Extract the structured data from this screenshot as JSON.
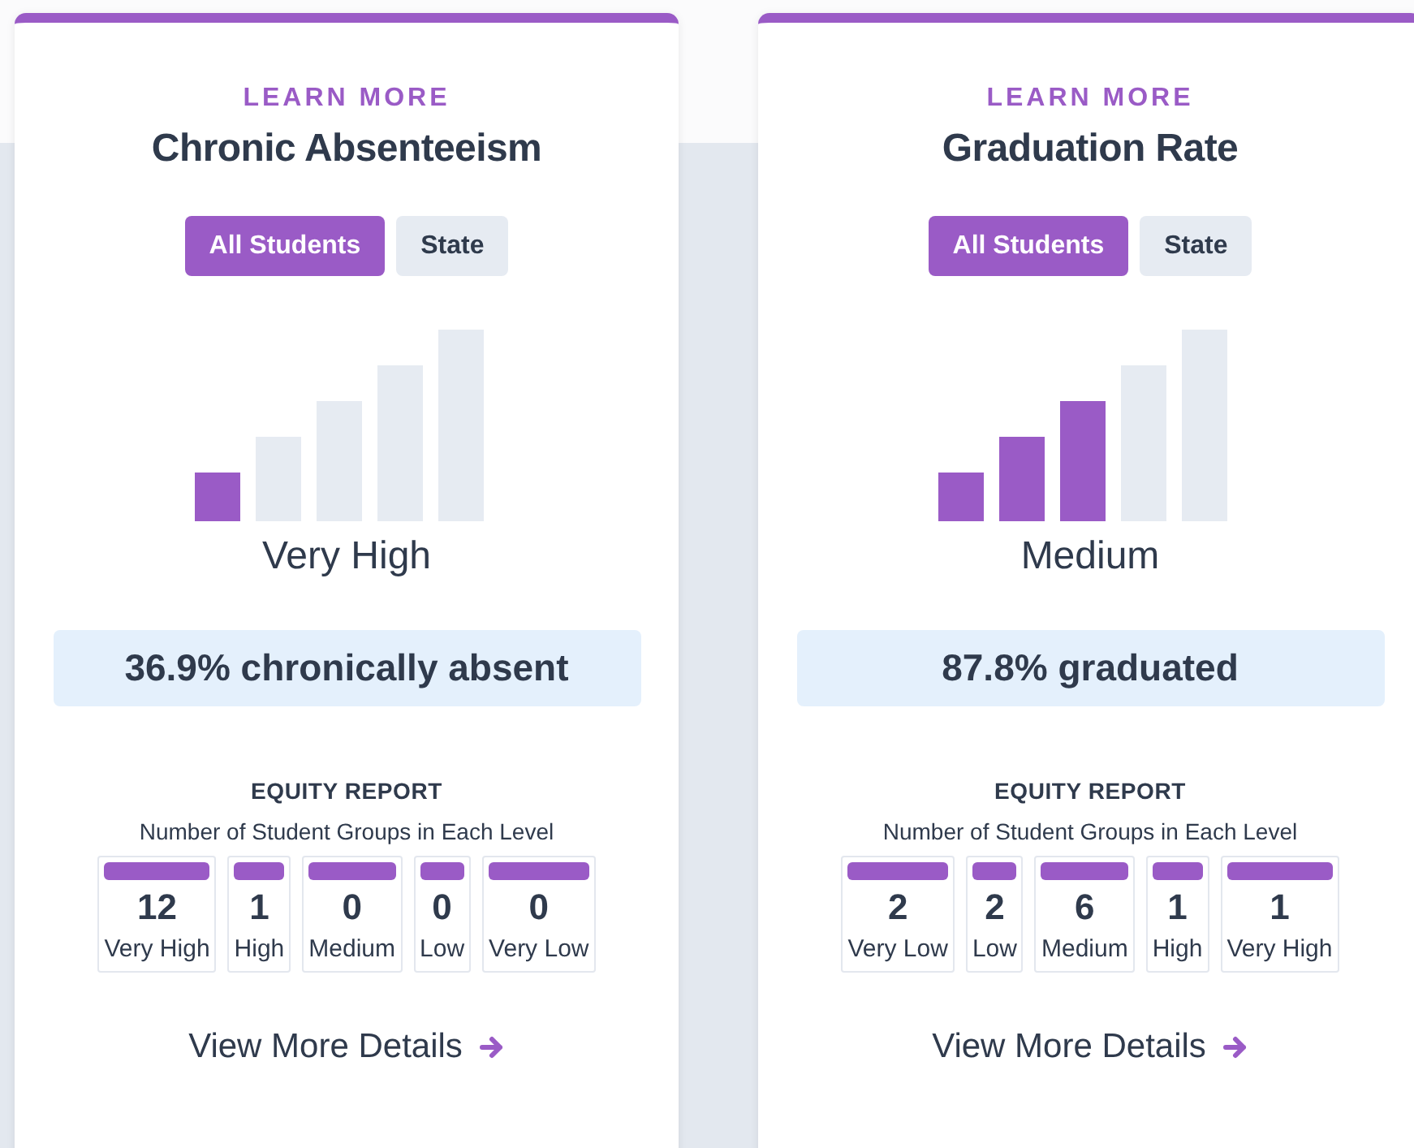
{
  "cards": [
    {
      "link": "LEARN MORE",
      "title": "Chronic Absenteeism",
      "toggles": [
        {
          "label": "All Students",
          "selected": true
        },
        {
          "label": "State",
          "selected": false
        }
      ],
      "level": 0.2,
      "rating": "Very High",
      "stat": "36.9% chronically absent",
      "equity": {
        "title": "EQUITY REPORT",
        "subtitle": "Number of Student Groups in Each Level",
        "groups": [
          {
            "count": "12",
            "label": "Very High"
          },
          {
            "count": "1",
            "label": "High"
          },
          {
            "count": "0",
            "label": "Medium"
          },
          {
            "count": "0",
            "label": "Low"
          },
          {
            "count": "0",
            "label": "Very Low"
          }
        ]
      },
      "details": "View More Details"
    },
    {
      "link": "LEARN MORE",
      "title": "Graduation Rate",
      "toggles": [
        {
          "label": "All Students",
          "selected": true
        },
        {
          "label": "State",
          "selected": false
        }
      ],
      "level": 0.6,
      "rating": "Medium",
      "stat": "87.8% graduated",
      "equity": {
        "title": "EQUITY REPORT",
        "subtitle": "Number of Student Groups in Each Level",
        "groups": [
          {
            "count": "2",
            "label": "Very Low"
          },
          {
            "count": "2",
            "label": "Low"
          },
          {
            "count": "6",
            "label": "Medium"
          },
          {
            "count": "1",
            "label": "High"
          },
          {
            "count": "1",
            "label": "Very High"
          }
        ]
      },
      "details": "View More Details"
    }
  ]
}
